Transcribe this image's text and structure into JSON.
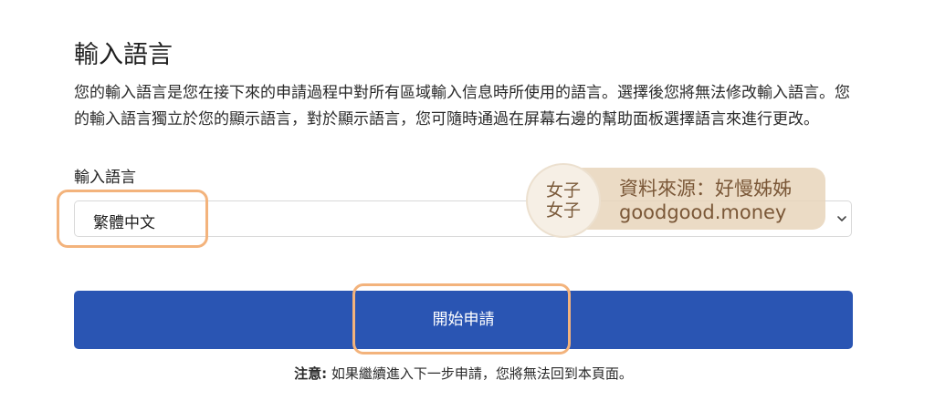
{
  "section": {
    "title": "輸入語言",
    "description": "您的輸入語言是您在接下來的申請過程中對所有區域輸入信息時所使用的語言。選擇後您將無法修改輸入語言。您的輸入語言獨立於您的顯示語言，對於顯示語言，您可隨時通過在屏幕右邊的幫助面板選擇語言來進行更改。"
  },
  "language_select": {
    "label": "輸入語言",
    "selected_value": "繁體中文",
    "icon": "chevron-down-icon"
  },
  "start_button": {
    "label": "開始申請",
    "color": "#2a55b3"
  },
  "note": {
    "prefix": "注意:",
    "text": " 如果繼續進入下一步申請，您將無法回到本頁面。"
  },
  "watermark": {
    "seal_line1": "女子",
    "seal_line2": "女子",
    "source_label": "資料來源：好慢姊姊",
    "site": "goodgood.money"
  },
  "colors": {
    "highlight": "#f3b37c",
    "watermark_bg": "#e8d5bb"
  }
}
